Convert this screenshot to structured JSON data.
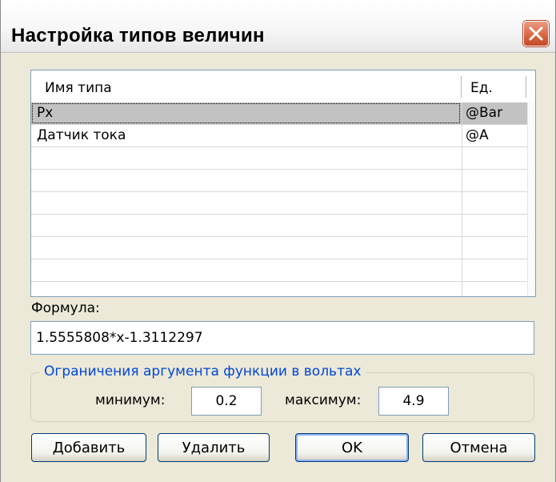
{
  "window": {
    "title": "Настройка типов величин"
  },
  "list": {
    "columns": [
      "Имя типа",
      "Ед."
    ],
    "rows": [
      {
        "name": "Px",
        "unit": "@Bar",
        "selected": true
      },
      {
        "name": "Датчик тока",
        "unit": "@A",
        "selected": false
      }
    ]
  },
  "formula": {
    "label": "Формула:",
    "value": "1.5555808*x-1.3112297"
  },
  "limits": {
    "group_title": "Ограничения аргумента функции в вольтах",
    "min_label": "минимум:",
    "min_value": "0.2",
    "max_label": "максимум:",
    "max_value": "4.9"
  },
  "buttons": {
    "add": "Добавить",
    "delete": "Удалить",
    "ok": "OK",
    "cancel": "Отмена"
  },
  "colors": {
    "close_button": "#d8643e",
    "group_title": "#0046d5",
    "selected_row": "#c2c2c2"
  },
  "icons": {
    "close": "close-x-icon"
  }
}
